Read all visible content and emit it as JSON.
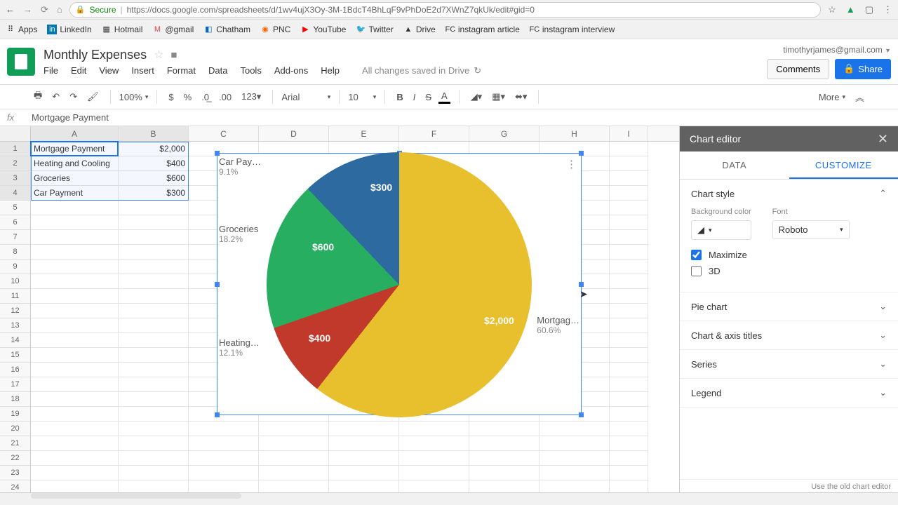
{
  "browser": {
    "secure": "Secure",
    "url": "https://docs.google.com/spreadsheets/d/1wv4ujX3Oy-3M-1BdcT4BhLqF9vPhDoE2d7XWnZ7qkUk/edit#gid=0",
    "bookmarks": [
      "Apps",
      "LinkedIn",
      "Hotmail",
      "@gmail",
      "Chatham",
      "PNC",
      "YouTube",
      "Twitter",
      "Drive",
      "instagram article",
      "instagram interview"
    ]
  },
  "doc": {
    "title": "Monthly Expenses",
    "menus": [
      "File",
      "Edit",
      "View",
      "Insert",
      "Format",
      "Data",
      "Tools",
      "Add-ons",
      "Help"
    ],
    "saved": "All changes saved in Drive",
    "email": "timothyrjames@gmail.com",
    "comments": "Comments",
    "share": "Share"
  },
  "toolbar": {
    "zoom": "100%",
    "font": "Arial",
    "size": "10",
    "more": "More"
  },
  "formula": "Mortgage Payment",
  "columns": [
    "A",
    "B",
    "C",
    "D",
    "E",
    "F",
    "G",
    "H",
    "I"
  ],
  "cells": {
    "rows": [
      {
        "a": "Mortgage Payment",
        "b": "$2,000"
      },
      {
        "a": "Heating and Cooling",
        "b": "$400"
      },
      {
        "a": "Groceries",
        "b": "$600"
      },
      {
        "a": "Car Payment",
        "b": "$300"
      }
    ]
  },
  "chart_data": {
    "type": "pie",
    "categories": [
      "Mortgage Payment",
      "Heating and Cooling",
      "Groceries",
      "Car Payment"
    ],
    "values": [
      2000,
      400,
      600,
      300
    ],
    "display_values": [
      "$2,000",
      "$400",
      "$600",
      "$300"
    ],
    "percent_labels": [
      "60.6%",
      "12.1%",
      "18.2%",
      "9.1%"
    ],
    "label_trunc": [
      "Mortgag…",
      "Heating…",
      "Groceries",
      "Car Pay…"
    ],
    "colors": [
      "#e8bf2c",
      "#2c6aa0",
      "#27ae60",
      "#c0392b"
    ]
  },
  "editor": {
    "title": "Chart editor",
    "tabs": {
      "data": "DATA",
      "customize": "CUSTOMIZE"
    },
    "style_section": "Chart style",
    "bg_label": "Background color",
    "font_label": "Font",
    "font_value": "Roboto",
    "maximize": "Maximize",
    "threeD": "3D",
    "sections": [
      "Pie chart",
      "Chart & axis titles",
      "Series",
      "Legend"
    ],
    "old": "Use the old chart editor"
  }
}
